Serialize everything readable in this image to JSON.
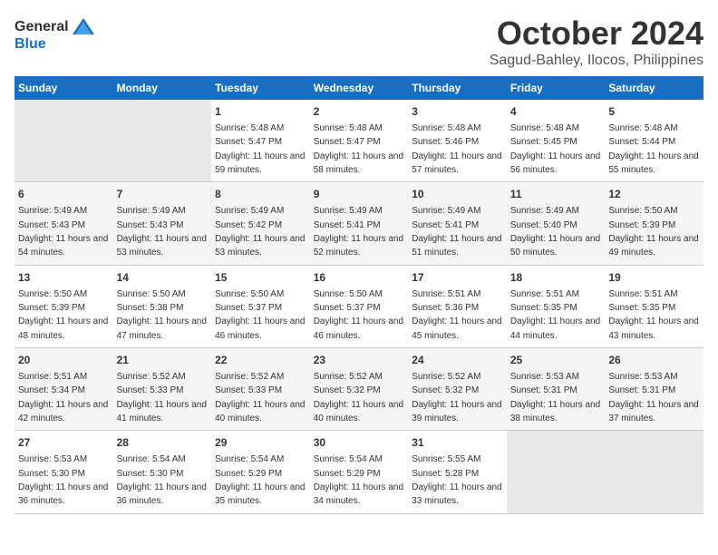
{
  "header": {
    "logo_general": "General",
    "logo_blue": "Blue",
    "month": "October 2024",
    "location": "Sagud-Bahley, Ilocos, Philippines"
  },
  "days_of_week": [
    "Sunday",
    "Monday",
    "Tuesday",
    "Wednesday",
    "Thursday",
    "Friday",
    "Saturday"
  ],
  "weeks": [
    [
      {
        "day": null,
        "sunrise": null,
        "sunset": null,
        "daylight": null
      },
      {
        "day": null,
        "sunrise": null,
        "sunset": null,
        "daylight": null
      },
      {
        "day": "1",
        "sunrise": "5:48 AM",
        "sunset": "5:47 PM",
        "daylight": "11 hours and 59 minutes."
      },
      {
        "day": "2",
        "sunrise": "5:48 AM",
        "sunset": "5:47 PM",
        "daylight": "11 hours and 58 minutes."
      },
      {
        "day": "3",
        "sunrise": "5:48 AM",
        "sunset": "5:46 PM",
        "daylight": "11 hours and 57 minutes."
      },
      {
        "day": "4",
        "sunrise": "5:48 AM",
        "sunset": "5:45 PM",
        "daylight": "11 hours and 56 minutes."
      },
      {
        "day": "5",
        "sunrise": "5:48 AM",
        "sunset": "5:44 PM",
        "daylight": "11 hours and 55 minutes."
      }
    ],
    [
      {
        "day": "6",
        "sunrise": "5:49 AM",
        "sunset": "5:43 PM",
        "daylight": "11 hours and 54 minutes."
      },
      {
        "day": "7",
        "sunrise": "5:49 AM",
        "sunset": "5:43 PM",
        "daylight": "11 hours and 53 minutes."
      },
      {
        "day": "8",
        "sunrise": "5:49 AM",
        "sunset": "5:42 PM",
        "daylight": "11 hours and 53 minutes."
      },
      {
        "day": "9",
        "sunrise": "5:49 AM",
        "sunset": "5:41 PM",
        "daylight": "11 hours and 52 minutes."
      },
      {
        "day": "10",
        "sunrise": "5:49 AM",
        "sunset": "5:41 PM",
        "daylight": "11 hours and 51 minutes."
      },
      {
        "day": "11",
        "sunrise": "5:49 AM",
        "sunset": "5:40 PM",
        "daylight": "11 hours and 50 minutes."
      },
      {
        "day": "12",
        "sunrise": "5:50 AM",
        "sunset": "5:39 PM",
        "daylight": "11 hours and 49 minutes."
      }
    ],
    [
      {
        "day": "13",
        "sunrise": "5:50 AM",
        "sunset": "5:39 PM",
        "daylight": "11 hours and 48 minutes."
      },
      {
        "day": "14",
        "sunrise": "5:50 AM",
        "sunset": "5:38 PM",
        "daylight": "11 hours and 47 minutes."
      },
      {
        "day": "15",
        "sunrise": "5:50 AM",
        "sunset": "5:37 PM",
        "daylight": "11 hours and 46 minutes."
      },
      {
        "day": "16",
        "sunrise": "5:50 AM",
        "sunset": "5:37 PM",
        "daylight": "11 hours and 46 minutes."
      },
      {
        "day": "17",
        "sunrise": "5:51 AM",
        "sunset": "5:36 PM",
        "daylight": "11 hours and 45 minutes."
      },
      {
        "day": "18",
        "sunrise": "5:51 AM",
        "sunset": "5:35 PM",
        "daylight": "11 hours and 44 minutes."
      },
      {
        "day": "19",
        "sunrise": "5:51 AM",
        "sunset": "5:35 PM",
        "daylight": "11 hours and 43 minutes."
      }
    ],
    [
      {
        "day": "20",
        "sunrise": "5:51 AM",
        "sunset": "5:34 PM",
        "daylight": "11 hours and 42 minutes."
      },
      {
        "day": "21",
        "sunrise": "5:52 AM",
        "sunset": "5:33 PM",
        "daylight": "11 hours and 41 minutes."
      },
      {
        "day": "22",
        "sunrise": "5:52 AM",
        "sunset": "5:33 PM",
        "daylight": "11 hours and 40 minutes."
      },
      {
        "day": "23",
        "sunrise": "5:52 AM",
        "sunset": "5:32 PM",
        "daylight": "11 hours and 40 minutes."
      },
      {
        "day": "24",
        "sunrise": "5:52 AM",
        "sunset": "5:32 PM",
        "daylight": "11 hours and 39 minutes."
      },
      {
        "day": "25",
        "sunrise": "5:53 AM",
        "sunset": "5:31 PM",
        "daylight": "11 hours and 38 minutes."
      },
      {
        "day": "26",
        "sunrise": "5:53 AM",
        "sunset": "5:31 PM",
        "daylight": "11 hours and 37 minutes."
      }
    ],
    [
      {
        "day": "27",
        "sunrise": "5:53 AM",
        "sunset": "5:30 PM",
        "daylight": "11 hours and 36 minutes."
      },
      {
        "day": "28",
        "sunrise": "5:54 AM",
        "sunset": "5:30 PM",
        "daylight": "11 hours and 36 minutes."
      },
      {
        "day": "29",
        "sunrise": "5:54 AM",
        "sunset": "5:29 PM",
        "daylight": "11 hours and 35 minutes."
      },
      {
        "day": "30",
        "sunrise": "5:54 AM",
        "sunset": "5:29 PM",
        "daylight": "11 hours and 34 minutes."
      },
      {
        "day": "31",
        "sunrise": "5:55 AM",
        "sunset": "5:28 PM",
        "daylight": "11 hours and 33 minutes."
      },
      {
        "day": null,
        "sunrise": null,
        "sunset": null,
        "daylight": null
      },
      {
        "day": null,
        "sunrise": null,
        "sunset": null,
        "daylight": null
      }
    ]
  ]
}
